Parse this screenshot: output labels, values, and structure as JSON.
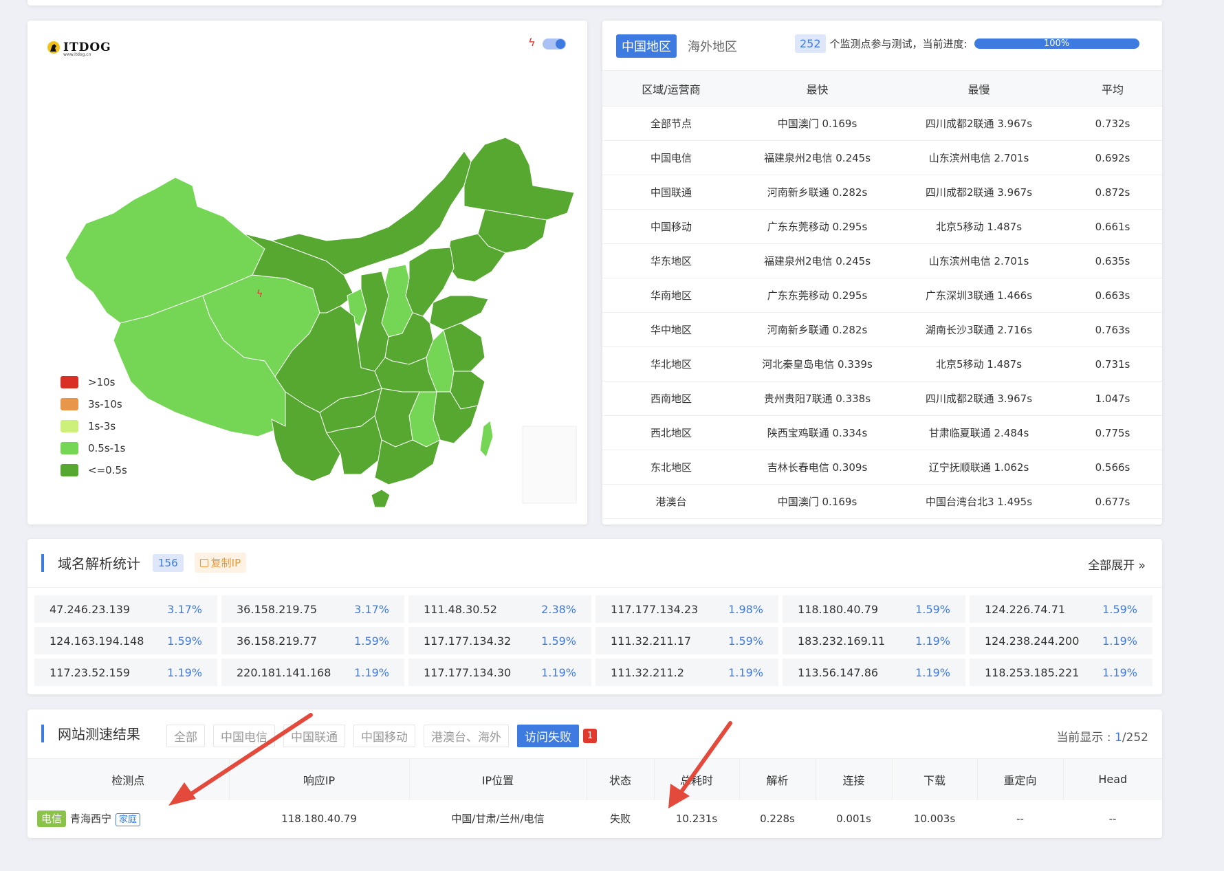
{
  "logo": {
    "text": "ITDOG",
    "sub": "www.itdog.cn"
  },
  "legend": [
    {
      "label": ">10s",
      "color": "#d93025"
    },
    {
      "label": "3s-10s",
      "color": "#e8964a"
    },
    {
      "label": "1s-3s",
      "color": "#cdf07a"
    },
    {
      "label": "0.5s-1s",
      "color": "#74d654"
    },
    {
      "label": "<=0.5s",
      "color": "#56a830"
    }
  ],
  "region_tabs": [
    "中国地区",
    "海外地区"
  ],
  "progress": {
    "count": "252",
    "text": "个监测点参与测试，当前进度:",
    "value": 1.0,
    "label": "100%"
  },
  "speed_table": {
    "headers": [
      "区域/运营商",
      "最快",
      "最慢",
      "平均"
    ],
    "rows": [
      [
        "全部节点",
        "中国澳门 0.169s",
        "四川成都2联通 3.967s",
        "0.732s"
      ],
      [
        "中国电信",
        "福建泉州2电信 0.245s",
        "山东滨州电信 2.701s",
        "0.692s"
      ],
      [
        "中国联通",
        "河南新乡联通 0.282s",
        "四川成都2联通 3.967s",
        "0.872s"
      ],
      [
        "中国移动",
        "广东东莞移动 0.295s",
        "北京5移动 1.487s",
        "0.661s"
      ],
      [
        "华东地区",
        "福建泉州2电信 0.245s",
        "山东滨州电信 2.701s",
        "0.635s"
      ],
      [
        "华南地区",
        "广东东莞移动 0.295s",
        "广东深圳3联通 1.466s",
        "0.663s"
      ],
      [
        "华中地区",
        "河南新乡联通 0.282s",
        "湖南长沙3联通 2.716s",
        "0.763s"
      ],
      [
        "华北地区",
        "河北秦皇岛电信 0.339s",
        "北京5移动 1.487s",
        "0.731s"
      ],
      [
        "西南地区",
        "贵州贵阳7联通 0.338s",
        "四川成都2联通 3.967s",
        "1.047s"
      ],
      [
        "西北地区",
        "陕西宝鸡联通 0.334s",
        "甘肃临夏联通 2.484s",
        "0.775s"
      ],
      [
        "东北地区",
        "吉林长春电信 0.309s",
        "辽宁抚顺联通 1.062s",
        "0.566s"
      ],
      [
        "港澳台",
        "中国澳门 0.169s",
        "中国台湾台北3 1.495s",
        "0.677s"
      ]
    ]
  },
  "dns": {
    "title": "域名解析统计",
    "count": "156",
    "copy_label": "复制IP",
    "expand_label": "全部展开",
    "items": [
      {
        "ip": "47.246.23.139",
        "pct": "3.17%"
      },
      {
        "ip": "36.158.219.75",
        "pct": "3.17%"
      },
      {
        "ip": "111.48.30.52",
        "pct": "2.38%"
      },
      {
        "ip": "117.177.134.23",
        "pct": "1.98%"
      },
      {
        "ip": "118.180.40.79",
        "pct": "1.59%"
      },
      {
        "ip": "124.226.74.71",
        "pct": "1.59%"
      },
      {
        "ip": "124.163.194.148",
        "pct": "1.59%"
      },
      {
        "ip": "36.158.219.77",
        "pct": "1.59%"
      },
      {
        "ip": "117.177.134.32",
        "pct": "1.59%"
      },
      {
        "ip": "111.32.211.17",
        "pct": "1.59%"
      },
      {
        "ip": "183.232.169.11",
        "pct": "1.19%"
      },
      {
        "ip": "124.238.244.200",
        "pct": "1.19%"
      },
      {
        "ip": "117.23.52.159",
        "pct": "1.19%"
      },
      {
        "ip": "220.181.141.168",
        "pct": "1.19%"
      },
      {
        "ip": "117.177.134.30",
        "pct": "1.19%"
      },
      {
        "ip": "111.32.211.2",
        "pct": "1.19%"
      },
      {
        "ip": "113.56.147.86",
        "pct": "1.19%"
      },
      {
        "ip": "118.253.185.221",
        "pct": "1.19%"
      }
    ]
  },
  "results": {
    "title": "网站测速结果",
    "filters": [
      "全部",
      "中国电信",
      "中国联通",
      "中国移动",
      "港澳台、海外",
      "访问失败"
    ],
    "fail_count": "1",
    "display_prefix": "当前显示 : ",
    "display_current": "1",
    "display_total": "/252",
    "headers": [
      "检测点",
      "响应IP",
      "IP位置",
      "状态",
      "总耗时",
      "解析",
      "连接",
      "下载",
      "重定向",
      "Head"
    ],
    "row": {
      "isp": "电信",
      "node": "青海西宁",
      "tag": "家庭",
      "ip": "118.180.40.79",
      "location": "中国/甘肃/兰州/电信",
      "status": "失败",
      "total": "10.231s",
      "dns": "0.228s",
      "connect": "0.001s",
      "download": "10.003s",
      "redirect": "--",
      "head": "--"
    }
  },
  "colors": {
    "accent": "#3d7be0",
    "fail": "#e0392d"
  }
}
